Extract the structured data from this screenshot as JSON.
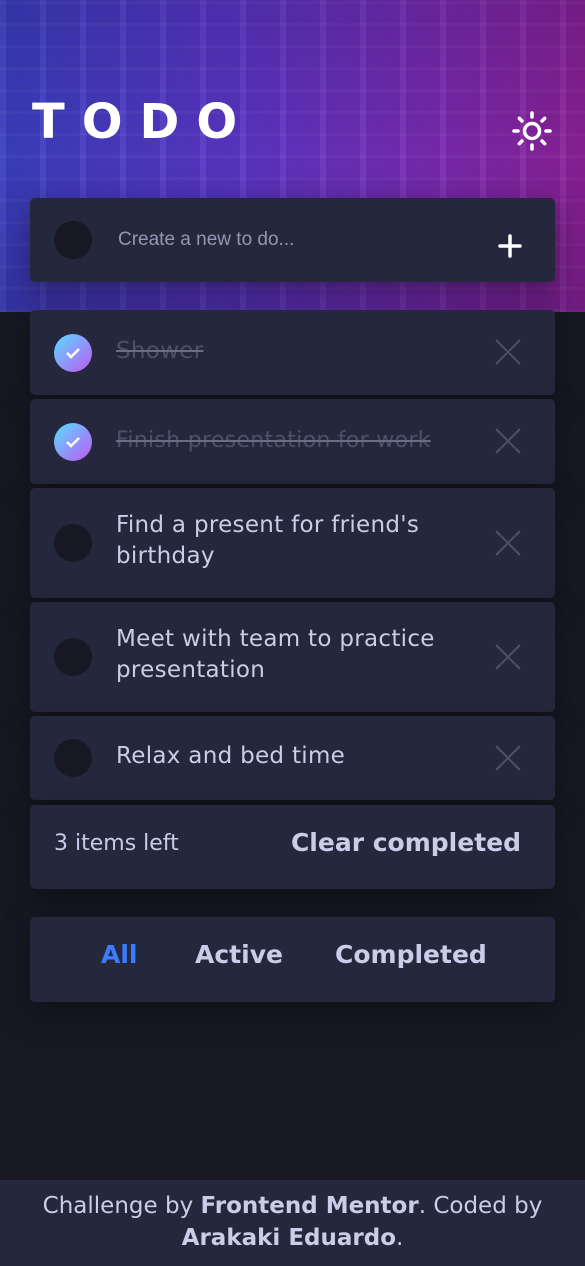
{
  "header": {
    "title": "TODO",
    "theme_icon": "sun-icon"
  },
  "new_todo": {
    "placeholder": "Create a new to do...",
    "add_icon": "plus-icon"
  },
  "todos": [
    {
      "text": "Shower",
      "completed": true
    },
    {
      "text": "Finish presentation for work",
      "completed": true
    },
    {
      "text": "Find a present for friend's birthday",
      "completed": false
    },
    {
      "text": "Meet with team to practice presentation",
      "completed": false
    },
    {
      "text": "Relax and bed time",
      "completed": false
    }
  ],
  "list_footer": {
    "items_left": "3 items left",
    "clear_label": "Clear completed"
  },
  "filters": {
    "all": "All",
    "active": "Active",
    "completed": "Completed",
    "selected": "All"
  },
  "attribution": {
    "prefix": "Challenge by ",
    "org": "Frontend Mentor",
    "middle": ". Coded by ",
    "author": "Arakaki Eduardo",
    "suffix": "."
  },
  "colors": {
    "background": "#181824",
    "card": "#25273d",
    "accent_blue": "#3a7cfd",
    "check_gradient_start": "#57ddff",
    "check_gradient_end": "#c058f3"
  }
}
